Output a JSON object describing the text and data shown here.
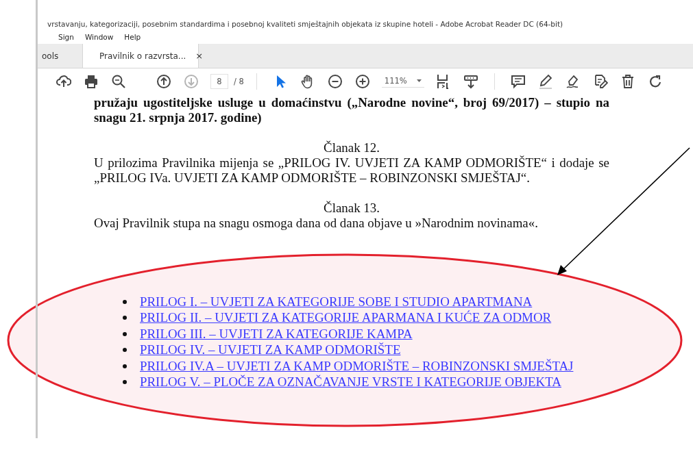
{
  "window": {
    "title": "vrstavanju, kategorizaciji, posebnim standardima i posebnoj kvaliteti smještajnih objekata iz skupine hoteli - Adobe Acrobat Reader DC (64-bit)"
  },
  "menu": [
    "Sign",
    "Window",
    "Help"
  ],
  "tabs": [
    {
      "label": "ools",
      "selected": false
    },
    {
      "label": "Pravilnik o razvrsta...",
      "selected": true,
      "close": "×"
    }
  ],
  "toolbar": [
    {
      "kind": "upload",
      "selected": false,
      "disabled": false
    },
    {
      "kind": "print",
      "selected": false,
      "disabled": false
    },
    {
      "kind": "search",
      "selected": false,
      "disabled": false
    },
    {
      "kind": "gap"
    },
    {
      "kind": "prev",
      "selected": false,
      "disabled": false
    },
    {
      "kind": "next",
      "selected": false,
      "disabled": true
    },
    {
      "kind": "page",
      "value": "8",
      "total": "/ 8"
    },
    {
      "kind": "separator"
    },
    {
      "kind": "select",
      "selected": true,
      "disabled": false
    },
    {
      "kind": "hand",
      "selected": false,
      "disabled": false
    },
    {
      "kind": "zoomout",
      "selected": false,
      "disabled": false
    },
    {
      "kind": "zoomin",
      "selected": false,
      "disabled": false
    },
    {
      "kind": "zoom",
      "value": "111%"
    },
    {
      "kind": "fit",
      "selected": false,
      "disabled": false
    },
    {
      "kind": "scroll",
      "selected": false,
      "disabled": false
    },
    {
      "kind": "separator"
    },
    {
      "kind": "comment",
      "selected": false,
      "disabled": false
    },
    {
      "kind": "highlight",
      "selected": false,
      "disabled": false
    },
    {
      "kind": "sign",
      "selected": false,
      "disabled": false
    },
    {
      "kind": "edit",
      "selected": false,
      "disabled": false
    },
    {
      "kind": "delete",
      "selected": false,
      "disabled": false
    },
    {
      "kind": "rotate",
      "selected": false,
      "disabled": false
    }
  ],
  "document": {
    "heading": "pružaju ugostiteljske usluge u domaćinstvu („Narodne novine“, broj  69/2017) – stupio na snagu 21. srpnja 2017. godine)",
    "articles": [
      {
        "title": "Članak 12.",
        "text": "U prilozima Pravilnika mijenja se „PRILOG IV. UVJETI ZA KAMP ODMORIŠTE“ i dodaje se „PRILOG IVa. UVJETI ZA KAMP ODMORIŠTE – ROBINZONSKI SMJEŠTAJ“."
      },
      {
        "title": "Članak 13.",
        "text": "Ovaj Pravilnik stupa na snagu osmoga dana od dana objave u »Narodnim novinama«."
      }
    ],
    "links": [
      "PRILOG I. – UVJETI ZA KATEGORIJE SOBE I STUDIO APARTMANA",
      "PRILOG II. – UVJETI ZA KATEGORIJE APARMANA I KUĆE ZA ODMOR",
      "PRILOG III. – UVJETI ZA KATEGORIJE KAMPA",
      "PRILOG IV. – UVJETI ZA KAMP ODMORIŠTE",
      "PRILOG IV.A – UVJETI ZA KAMP ODMORIŠTE – ROBINZONSKI SMJEŠTAJ",
      "PRILOG V. – PLOČE ZA OZNAČAVANJE VRSTE I KATEGORIJE OBJEKTA"
    ]
  }
}
